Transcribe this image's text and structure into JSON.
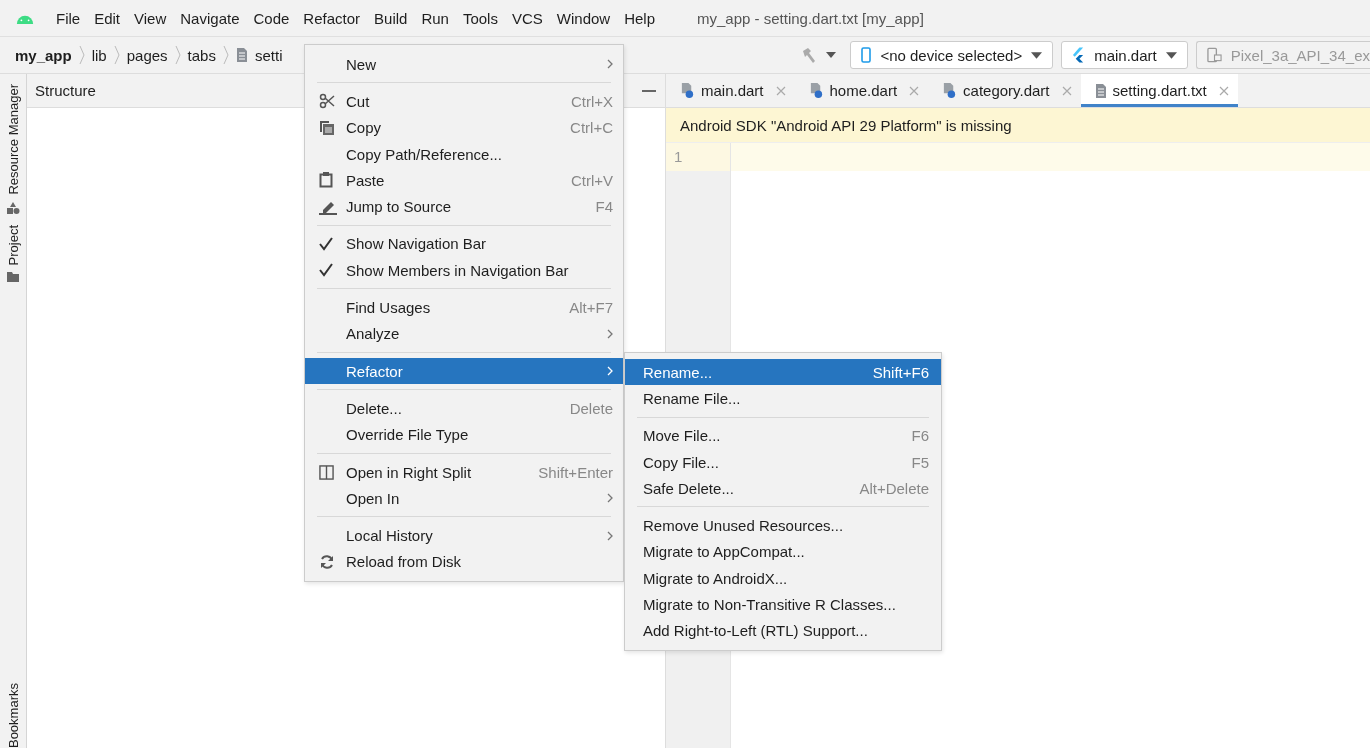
{
  "menu_bar": [
    "File",
    "Edit",
    "View",
    "Navigate",
    "Code",
    "Refactor",
    "Build",
    "Run",
    "Tools",
    "VCS",
    "Window",
    "Help"
  ],
  "window": {
    "title": "my_app - setting.dart.txt [my_app]"
  },
  "breadcrumb": [
    {
      "label": "my_app",
      "kind": "project"
    },
    {
      "label": "lib",
      "kind": "folder"
    },
    {
      "label": "pages",
      "kind": "folder"
    },
    {
      "label": "tabs",
      "kind": "folder"
    },
    {
      "label": "setti",
      "kind": "file"
    }
  ],
  "toolbar": {
    "device": "<no device selected>",
    "run_config": "main.dart",
    "emulator": "Pixel_3a_API_34_ex"
  },
  "side_strip": [
    {
      "label": "Resource Manager",
      "kind": "resources"
    },
    {
      "label": "Project",
      "kind": "folder"
    },
    {
      "label": "Bookmarks",
      "kind": "plain"
    }
  ],
  "structure_panel": {
    "title": "Structure"
  },
  "editor_tabs": [
    {
      "label": "main.dart",
      "kind": "dart",
      "selected": false
    },
    {
      "label": "home.dart",
      "kind": "dart",
      "selected": false
    },
    {
      "label": "category.dart",
      "kind": "dart",
      "selected": false
    },
    {
      "label": "setting.dart.txt",
      "kind": "text",
      "selected": true
    }
  ],
  "banner": "Android SDK \"Android API 29 Platform\" is missing",
  "line_numbers": [
    "1"
  ],
  "context_menu": [
    {
      "kind": "plain",
      "label": "New",
      "submenu": true,
      "selected": false
    },
    {
      "kind": "separator"
    },
    {
      "kind": "cut",
      "label": "Cut",
      "shortcut": "Ctrl+X",
      "selected": false
    },
    {
      "kind": "copy",
      "label": "Copy",
      "shortcut": "Ctrl+C",
      "selected": false
    },
    {
      "kind": "plain",
      "label": "Copy Path/Reference...",
      "selected": false
    },
    {
      "kind": "paste",
      "label": "Paste",
      "shortcut": "Ctrl+V",
      "selected": false
    },
    {
      "kind": "edit",
      "label": "Jump to Source",
      "shortcut": "F4",
      "selected": false
    },
    {
      "kind": "separator"
    },
    {
      "kind": "check",
      "label": "Show Navigation Bar",
      "checked": true,
      "selected": false
    },
    {
      "kind": "check",
      "label": "Show Members in Navigation Bar",
      "checked": true,
      "selected": false
    },
    {
      "kind": "separator"
    },
    {
      "kind": "plain",
      "label": "Find Usages",
      "shortcut": "Alt+F7",
      "selected": false
    },
    {
      "kind": "plain",
      "label": "Analyze",
      "submenu": true,
      "selected": false
    },
    {
      "kind": "separator"
    },
    {
      "kind": "plain",
      "label": "Refactor",
      "submenu": true,
      "selected": true
    },
    {
      "kind": "separator"
    },
    {
      "kind": "plain",
      "label": "Delete...",
      "shortcut": "Delete",
      "selected": false
    },
    {
      "kind": "plain",
      "label": "Override File Type",
      "selected": false
    },
    {
      "kind": "separator"
    },
    {
      "kind": "split",
      "label": "Open in Right Split",
      "shortcut": "Shift+Enter",
      "selected": false
    },
    {
      "kind": "plain",
      "label": "Open In",
      "submenu": true,
      "selected": false
    },
    {
      "kind": "separator"
    },
    {
      "kind": "plain",
      "label": "Local History",
      "submenu": true,
      "selected": false
    },
    {
      "kind": "reload",
      "label": "Reload from Disk",
      "selected": false
    }
  ],
  "submenu": [
    {
      "kind": "item",
      "label": "Rename...",
      "shortcut": "Shift+F6",
      "selected": true
    },
    {
      "kind": "item",
      "label": "Rename File...",
      "selected": false
    },
    {
      "kind": "separator"
    },
    {
      "kind": "item",
      "label": "Move File...",
      "shortcut": "F6",
      "selected": false
    },
    {
      "kind": "item",
      "label": "Copy File...",
      "shortcut": "F5",
      "selected": false
    },
    {
      "kind": "item",
      "label": "Safe Delete...",
      "shortcut": "Alt+Delete",
      "selected": false
    },
    {
      "kind": "separator"
    },
    {
      "kind": "item",
      "label": "Remove Unused Resources...",
      "selected": false
    },
    {
      "kind": "item",
      "label": "Migrate to AppCompat...",
      "selected": false
    },
    {
      "kind": "item",
      "label": "Migrate to AndroidX...",
      "selected": false
    },
    {
      "kind": "item",
      "label": "Migrate to Non-Transitive R Classes...",
      "selected": false
    },
    {
      "kind": "item",
      "label": "Add Right-to-Left (RTL) Support...",
      "selected": false
    }
  ]
}
